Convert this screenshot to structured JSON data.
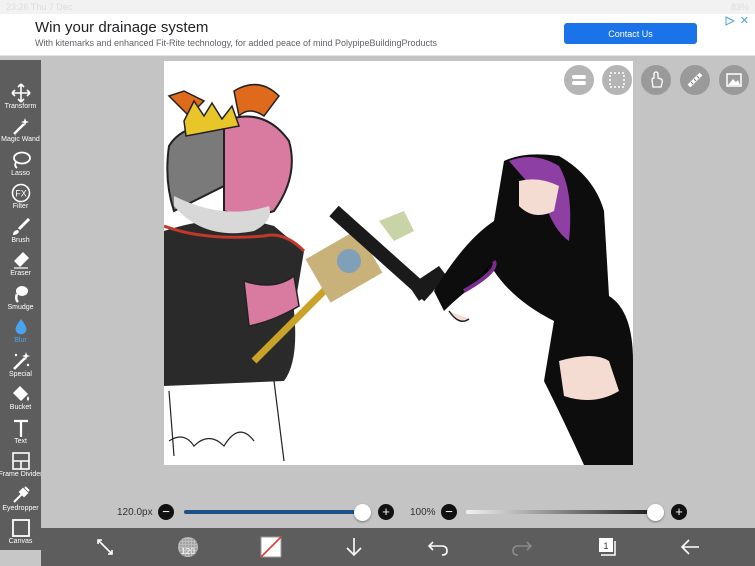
{
  "status_bar": {
    "time": "23:26",
    "date": "Thu 7 Dec",
    "battery": "83%"
  },
  "ad": {
    "title": "Win your drainage system",
    "subtitle": "With kitemarks and enhanced Fit-Rite technology, for added peace of mind PolypipeBuildingProducts",
    "button": "Contact Us",
    "close": "✕"
  },
  "toolbar": {
    "items": [
      {
        "label": "Transform",
        "icon": "transform-icon"
      },
      {
        "label": "Magic Wand",
        "icon": "magic-wand-icon"
      },
      {
        "label": "Lasso",
        "icon": "lasso-icon"
      },
      {
        "label": "Filter",
        "icon": "fx-icon"
      },
      {
        "label": "Brush",
        "icon": "brush-icon"
      },
      {
        "label": "Eraser",
        "icon": "eraser-icon"
      },
      {
        "label": "Smudge",
        "icon": "smudge-icon"
      },
      {
        "label": "Blur",
        "icon": "blur-icon"
      },
      {
        "label": "Special",
        "icon": "special-icon"
      },
      {
        "label": "Bucket",
        "icon": "bucket-icon"
      },
      {
        "label": "Text",
        "icon": "text-icon"
      },
      {
        "label": "Frame Divider",
        "icon": "frame-divider-icon"
      },
      {
        "label": "Eyedropper",
        "icon": "eyedropper-icon"
      },
      {
        "label": "Canvas",
        "icon": "canvas-icon"
      }
    ],
    "active": "Blur",
    "active_color": "#4aa3f0"
  },
  "brush": {
    "size_label": "120.0px",
    "opacity_label": "100%",
    "size_value": 1.0,
    "opacity_value": 1.0,
    "bottom_size": "120"
  },
  "colors": {
    "toolbar_bg": "#5d5d5d",
    "accent": "#1a73e8",
    "size_track": "#1e4f86"
  }
}
